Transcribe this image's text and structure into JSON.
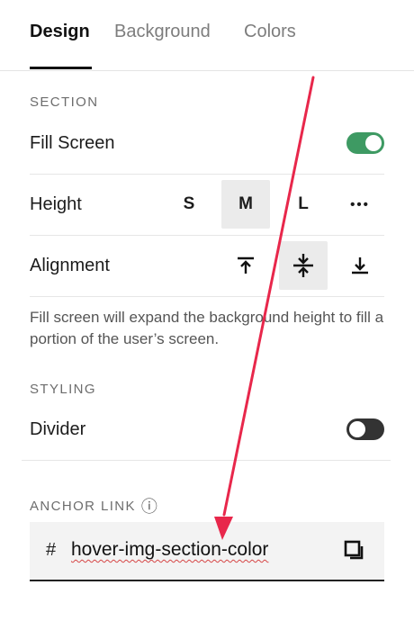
{
  "tabs": [
    {
      "label": "Design",
      "active": true
    },
    {
      "label": "Background",
      "active": false
    },
    {
      "label": "Colors",
      "active": false
    }
  ],
  "section": {
    "heading": "SECTION",
    "fill_screen": {
      "label": "Fill Screen",
      "enabled": true
    },
    "height": {
      "label": "Height",
      "options": [
        "S",
        "M",
        "L"
      ],
      "selected": "M",
      "more": "•••"
    },
    "alignment": {
      "label": "Alignment",
      "options": [
        "top",
        "center",
        "bottom"
      ],
      "selected": "center"
    },
    "help_text": "Fill screen will expand the background height to fill a portion of the user’s screen."
  },
  "styling": {
    "heading": "STYLING",
    "divider": {
      "label": "Divider",
      "enabled": false
    }
  },
  "anchor": {
    "heading": "ANCHOR LINK",
    "info_icon": "ⓘ",
    "prefix": "#",
    "value": "hover-img-section-color"
  },
  "colors": {
    "toggle_on": "#3e9a63",
    "toggle_off": "#333333",
    "annotation_arrow": "#e8274b"
  }
}
